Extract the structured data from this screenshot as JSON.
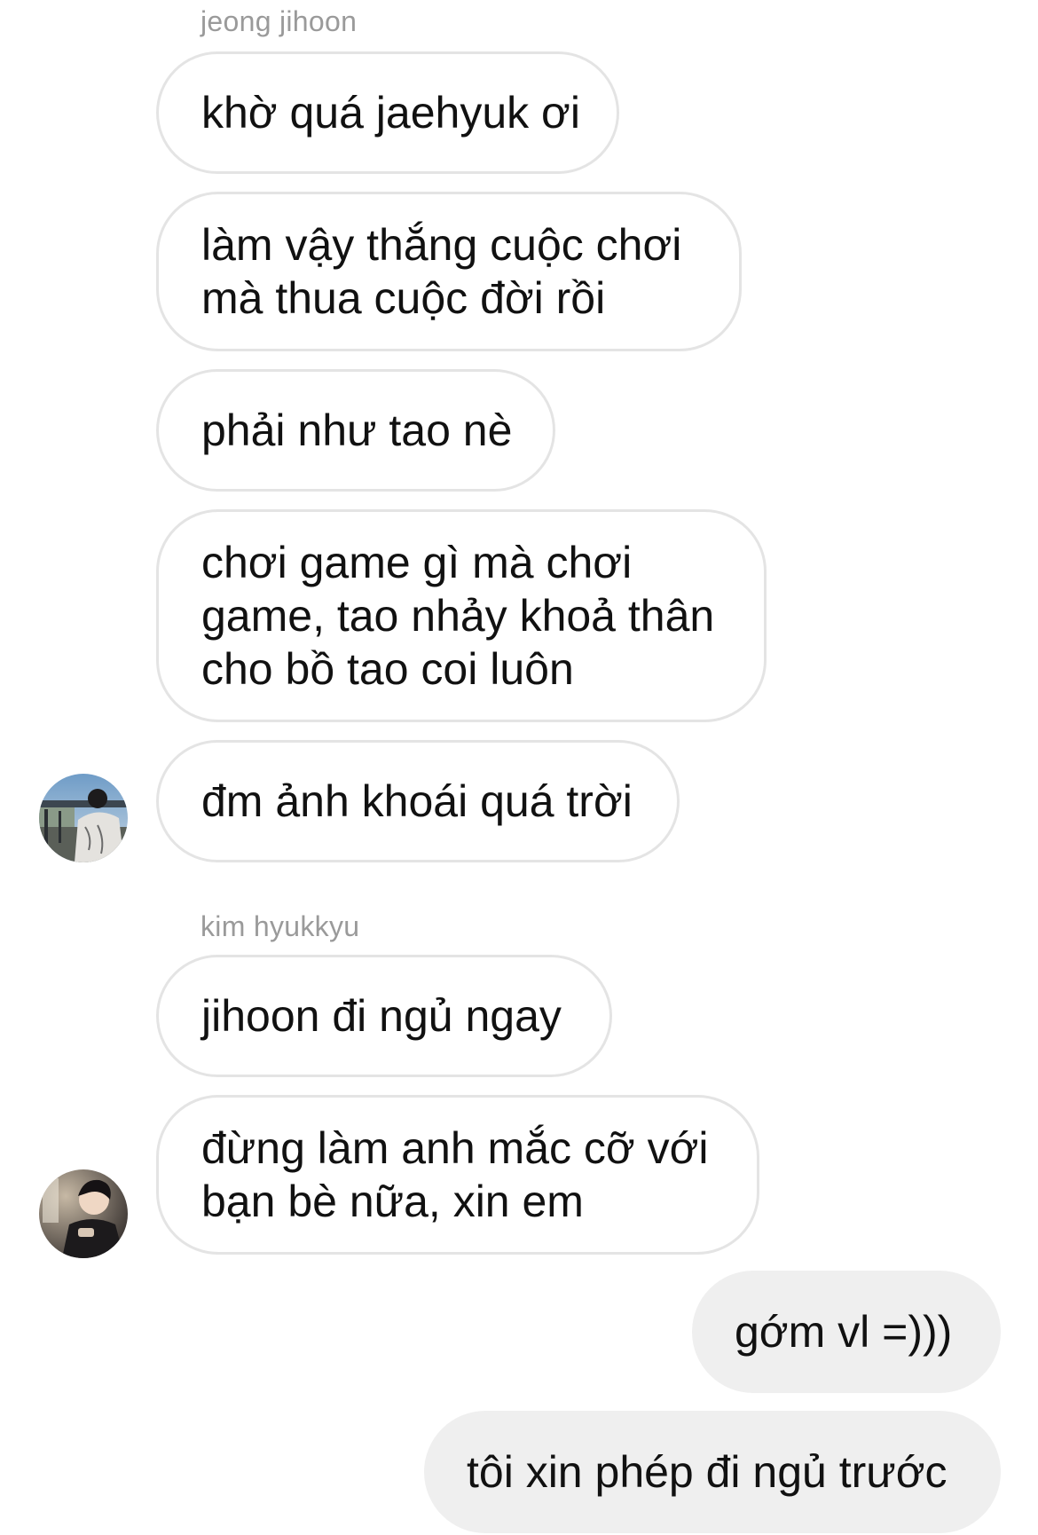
{
  "thread": {
    "group1": {
      "sender": "jeong jihoon",
      "messages": [
        {
          "lines": [
            "khờ quá jaehyuk ơi"
          ]
        },
        {
          "lines": [
            "làm vậy thắng cuộc chơi",
            "mà thua cuộc đời rồi"
          ]
        },
        {
          "lines": [
            "phải như tao nè"
          ]
        },
        {
          "lines": [
            "chơi game gì mà chơi",
            "game, tao nhảy khoả thân",
            "cho bồ tao coi luôn"
          ]
        },
        {
          "lines": [
            "đm ảnh khoái quá trời"
          ]
        }
      ]
    },
    "group2": {
      "sender": "kim hyukkyu",
      "messages": [
        {
          "lines": [
            "jihoon đi ngủ ngay"
          ]
        },
        {
          "lines": [
            "đừng làm anh mắc cỡ với",
            "bạn bè nữa, xin em"
          ]
        }
      ]
    },
    "outgoing": {
      "messages": [
        {
          "lines": [
            "gớm vl =)))"
          ]
        },
        {
          "lines": [
            "tôi xin phép đi ngủ trước"
          ]
        }
      ]
    }
  }
}
